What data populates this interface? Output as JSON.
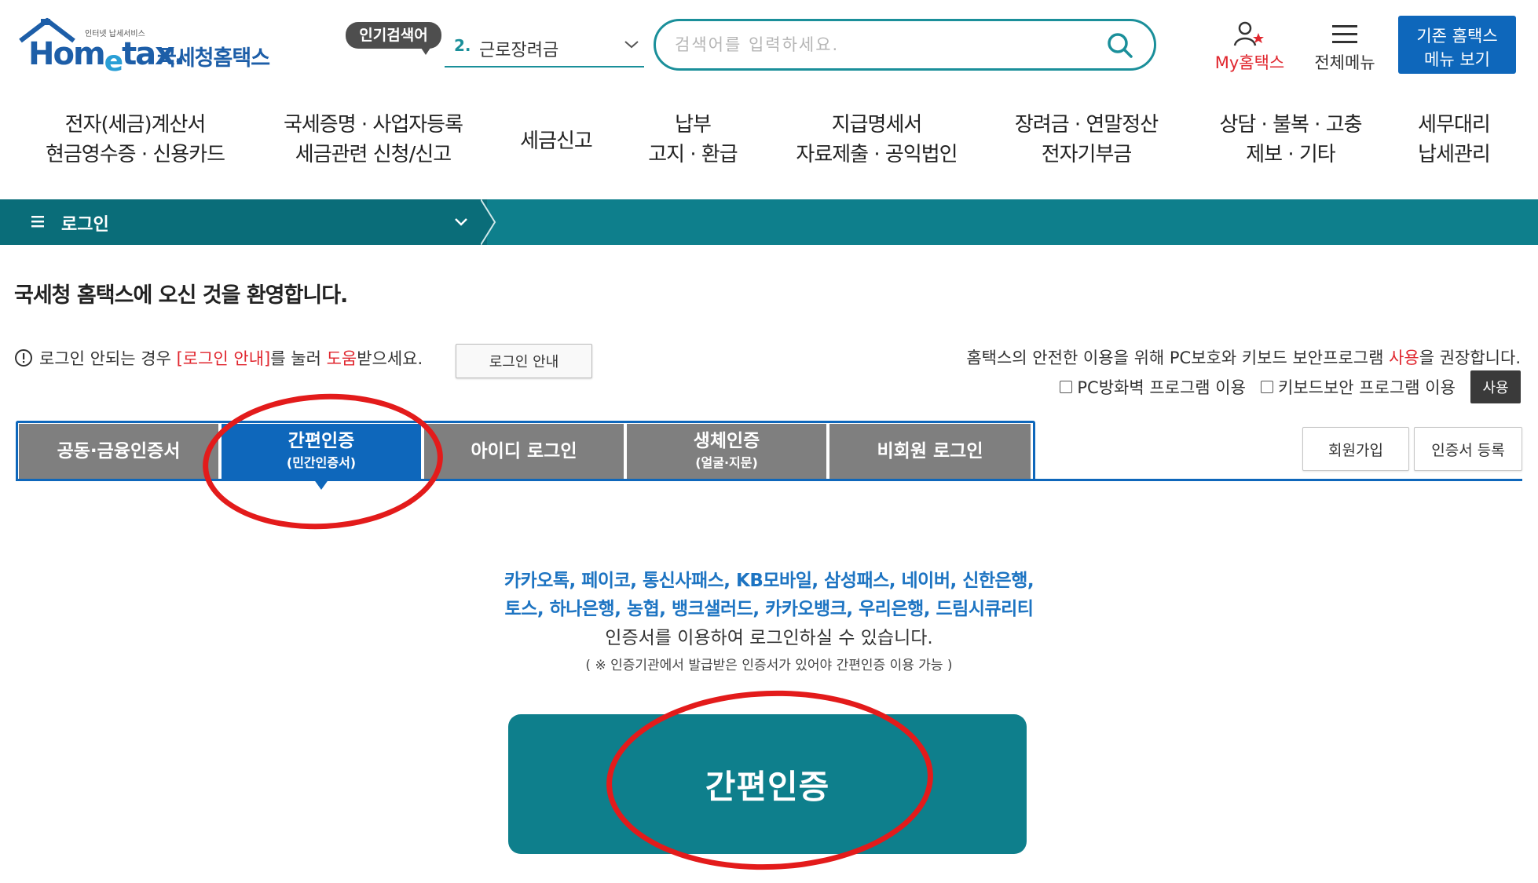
{
  "header": {
    "logo_en": "Hometax",
    "logo_sub": "인터넷 납세서비스",
    "logo_kr": "국세청홈택스",
    "popular_badge": "인기검색어",
    "popular_rank": "2.",
    "popular_term": "근로장려금",
    "search_placeholder": "검색어를 입력하세요.",
    "my_hometax": "My홈택스",
    "all_menu": "전체메뉴",
    "old_menu_line1": "기존 홈택스",
    "old_menu_line2": "메뉴 보기"
  },
  "gnb": [
    {
      "line1": "전자(세금)계산서",
      "line2": "현금영수증 · 신용카드"
    },
    {
      "line1": "국세증명 · 사업자등록",
      "line2": "세금관련 신청/신고"
    },
    {
      "line1": "세금신고",
      "line2": ""
    },
    {
      "line1": "납부",
      "line2": "고지 · 환급"
    },
    {
      "line1": "지급명세서",
      "line2": "자료제출 · 공익법인"
    },
    {
      "line1": "장려금 · 연말정산",
      "line2": "전자기부금"
    },
    {
      "line1": "상담 · 불복 · 고충",
      "line2": "제보 · 기타"
    },
    {
      "line1": "세무대리",
      "line2": "납세관리"
    }
  ],
  "location": {
    "title": "로그인"
  },
  "welcome": "국세청 홈택스에 오신 것을 환영합니다.",
  "help": {
    "part1": "로그인 안되는 경우 ",
    "red1": "[로그인 안내]",
    "part2": "를 눌러 ",
    "red2": "도움",
    "part3": "받으세요.",
    "button": "로그인 안내"
  },
  "security": {
    "note_part1": "홈택스의 안전한 이용을 위해 PC보호와 키보드 보안프로그램 ",
    "note_red": "사용",
    "note_part2": "을 권장합니다.",
    "opt1": "PC방화벽 프로그램 이용",
    "opt2": "키보드보안 프로그램 이용",
    "use_button": "사용"
  },
  "tabs": [
    {
      "label": "공동·금융인증서",
      "sub": ""
    },
    {
      "label": "간편인증",
      "sub": "(민간인증서)"
    },
    {
      "label": "아이디 로그인",
      "sub": ""
    },
    {
      "label": "생체인증",
      "sub": "(얼굴·지문)"
    },
    {
      "label": "비회원 로그인",
      "sub": ""
    }
  ],
  "side_buttons": {
    "signup": "회원가입",
    "cert_register": "인증서 등록"
  },
  "simple_auth": {
    "providers_line1": "카카오톡, 페이코, 통신사패스, KB모바일, 삼성패스, 네이버, 신한은행,",
    "providers_line2": "토스, 하나은행, 농협, 뱅크샐러드, 카카오뱅크, 우리은행, 드림시큐리티",
    "description": "인증서를 이용하여 로그인하실 수 있습니다.",
    "note": "( ※ 인증기관에서 발급받은 인증서가 있어야 간편인증 이용 가능 )",
    "button": "간편인증"
  },
  "colors": {
    "teal": "#0e7f8c",
    "blue": "#0e67bb",
    "red_annotation": "#e31b1b",
    "tab_gray": "#7f7f7f"
  }
}
